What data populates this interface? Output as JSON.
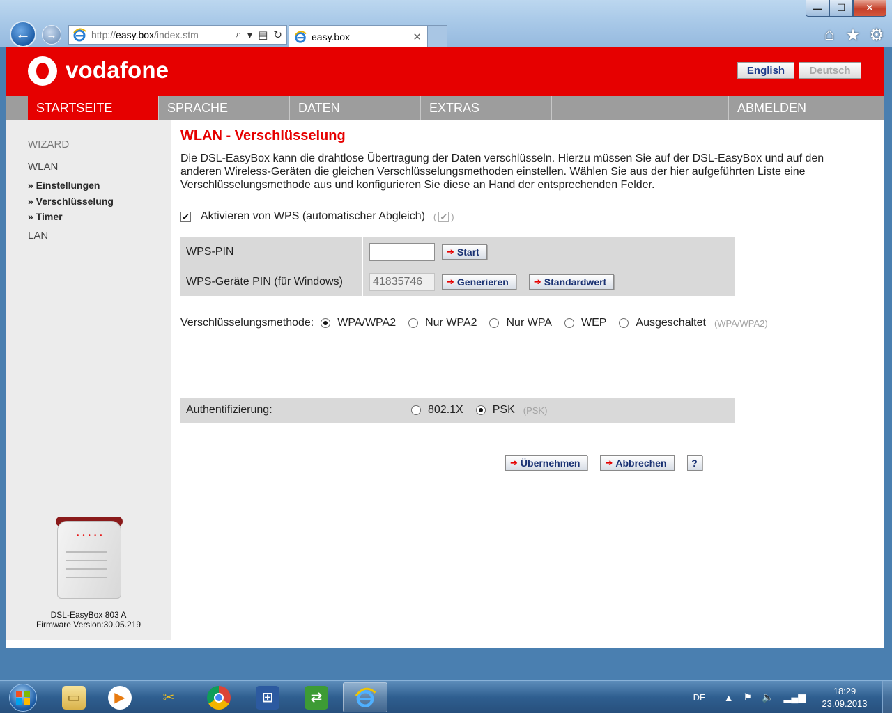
{
  "browser": {
    "url_prefix": "http://",
    "url_host": "easy.box",
    "url_path": "/index.stm",
    "tab_title": "easy.box",
    "tab_close": "✕",
    "address_tools": [
      "⌕",
      "▾",
      "▤",
      "↻"
    ],
    "window_buttons": {
      "minimize": "—",
      "maximize": "☐",
      "close": "✕"
    },
    "right_icons": [
      "home-icon",
      "favorites-star-icon",
      "settings-gear-icon"
    ]
  },
  "header": {
    "brand": "vodafone",
    "lang_english": "English",
    "lang_deutsch": "Deutsch"
  },
  "nav": {
    "items": [
      "STARTSEITE",
      "SPRACHE",
      "DATEN",
      "EXTRAS",
      "ABMELDEN"
    ],
    "active": "STARTSEITE"
  },
  "sidebar": {
    "items": [
      "WIZARD",
      "WLAN",
      "LAN"
    ],
    "subitems": [
      "» Einstellungen",
      "» Verschlüsselung",
      "» Timer"
    ],
    "device_name": "DSL-EasyBox 803 A",
    "firmware": "Firmware Version:30.05.219"
  },
  "page": {
    "title": "WLAN - Verschlüsselung",
    "intro": "Die DSL-EasyBox kann die drahtlose Übertragung der Daten verschlüsseln. Hierzu müssen Sie auf der DSL-EasyBox und auf den anderen Wireless-Geräten die gleichen Verschlüsselungsmethoden einstellen. Wählen Sie aus der hier aufgeführten Liste eine Verschlüsselungsmethode aus und konfigurieren Sie diese an Hand der entsprechenden Felder.",
    "wps_label": "Aktivieren von WPS (automatischer Abgleich)",
    "wps_checked": true,
    "wps_default_open": "(",
    "wps_default_close": ")",
    "wps_pin_label": "WPS-PIN",
    "wps_pin_value": "",
    "start_button": "Start",
    "device_pin_label": "WPS-Geräte PIN (für Windows)",
    "device_pin_value": "41835746",
    "generate_button": "Generieren",
    "default_button": "Standardwert",
    "method_label": "Verschlüsselungsmethode:",
    "methods": [
      "WPA/WPA2",
      "Nur WPA2",
      "Nur WPA",
      "WEP",
      "Ausgeschaltet"
    ],
    "method_selected": "WPA/WPA2",
    "method_default_hint": "(WPA/WPA2)",
    "auth_label": "Authentifizierung:",
    "auth_options": [
      "802.1X",
      "PSK"
    ],
    "auth_selected": "PSK",
    "auth_default_hint": "(PSK)",
    "apply_button": "Übernehmen",
    "cancel_button": "Abbrechen",
    "help_button": "?"
  },
  "taskbar": {
    "apps": [
      "file-explorer-icon",
      "media-player-icon",
      "tools-icon",
      "chrome-icon",
      "network-icon",
      "remote-desktop-icon",
      "internet-explorer-icon"
    ],
    "active_app": "internet-explorer-icon",
    "language": "DE",
    "time": "18:29",
    "date": "23.09.2013"
  }
}
